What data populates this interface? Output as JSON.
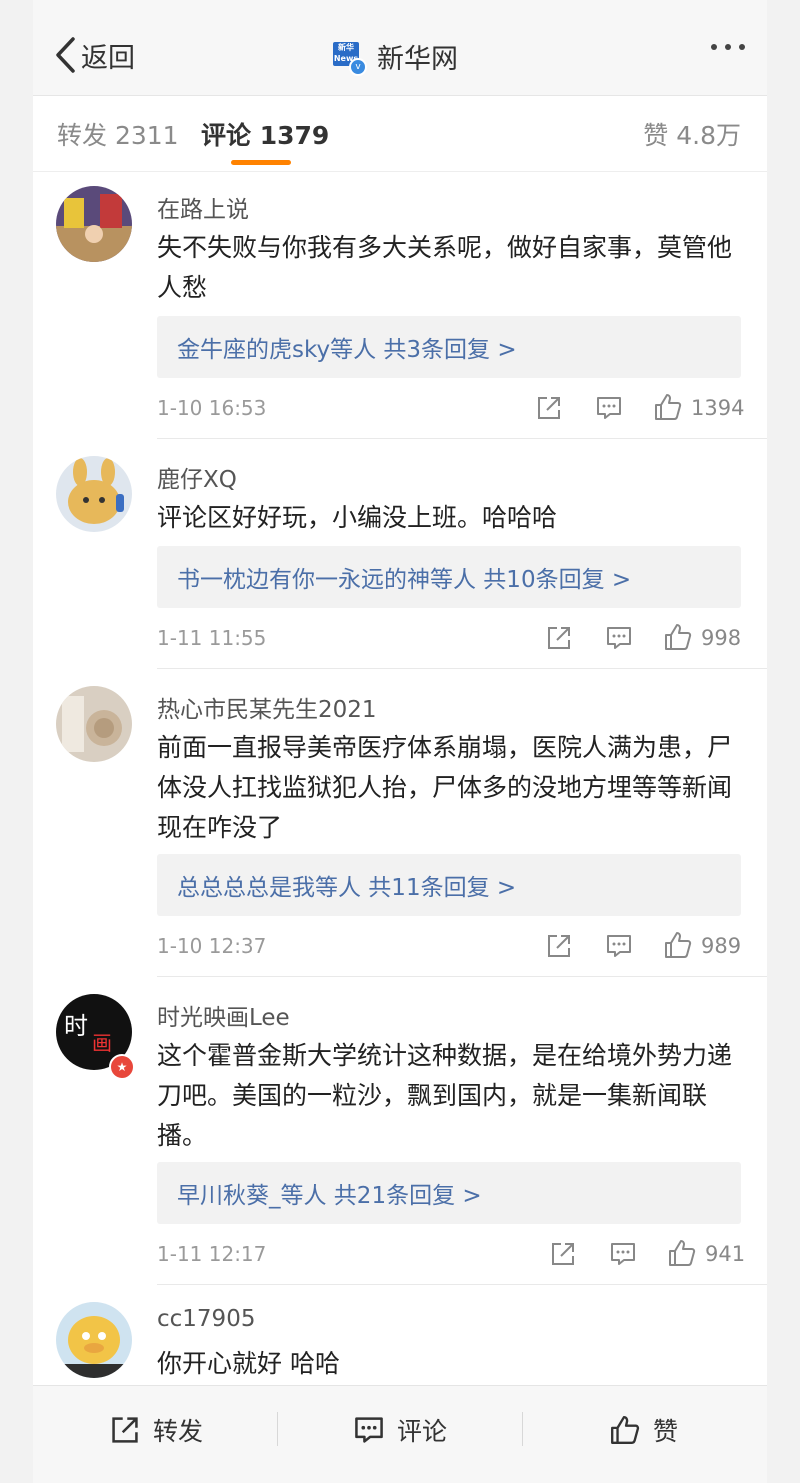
{
  "header": {
    "back_label": "返回",
    "account_name": "新华网",
    "logo_text": "新华网 News"
  },
  "tabs": {
    "repost": "转发 2311",
    "comment": "评论 1379",
    "like": "赞 4.8万",
    "active_color": "#ff8200"
  },
  "comments": [
    {
      "user": "在路上说",
      "text": "失不失败与你我有多大关系呢，做好自家事，莫管他人愁",
      "replies": "金牛座的虎sky等人  共3条回复 >",
      "time": "1-10 16:53",
      "likes": "1394"
    },
    {
      "user": "鹿仔XQ",
      "text": "评论区好好玩，小编没上班。哈哈哈",
      "replies": "书一枕边有你一永远的神等人  共10条回复 >",
      "time": "1-11 11:55",
      "likes": "998"
    },
    {
      "user": "热心市民某先生2021",
      "text": "前面一直报导美帝医疗体系崩塌，医院人满为患，尸体没人扛找监狱犯人抬，尸体多的没地方埋等等新闻现在咋没了",
      "replies": "总总总总是我等人  共11条回复 >",
      "time": "1-10 12:37",
      "likes": "989"
    },
    {
      "user": "时光映画Lee",
      "text": "这个霍普金斯大学统计这种数据，是在给境外势力递刀吧。美国的一粒沙，飘到国内，就是一集新闻联播。",
      "replies": "早川秋葵_等人  共21条回复 >",
      "time": "1-11 12:17",
      "likes": "941"
    },
    {
      "user": "cc17905",
      "text": "你开心就好 哈哈"
    }
  ],
  "bottom_bar": {
    "repost": "转发",
    "comment": "评论",
    "like": "赞"
  },
  "icons": [
    "back-chevron-icon",
    "verified-icon",
    "more-icon",
    "share-icon",
    "comment-icon",
    "like-icon"
  ]
}
